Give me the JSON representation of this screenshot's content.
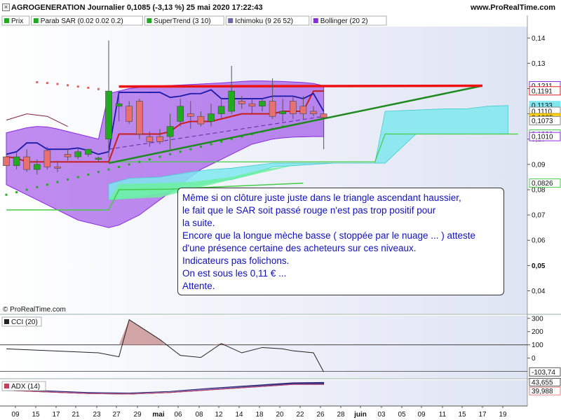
{
  "header": {
    "title": "AGROGENERATION Journalier 0,1085 (-3,13 %) 25 mai 2020 17:22:43",
    "site": "www.ProRealTime.com",
    "close_glyph": "×"
  },
  "legend": [
    {
      "label": "Prix",
      "color": "#22aa22"
    },
    {
      "label": "Parab SAR (0.02 0.02 0.2)",
      "color": "#22aa22"
    },
    {
      "label": "SuperTrend (3 10)",
      "color": "#22aa22"
    },
    {
      "label": "Ichimoku (9 26 52)",
      "color": "#6a6aaa"
    },
    {
      "label": "Bollinger (20 2)",
      "color": "#8a2be2"
    }
  ],
  "watermark": "© ProRealTime.com",
  "note": {
    "lines": [
      "Même si on clôture juste juste dans le triangle ascendant haussier,",
      "le fait que le SAR soit passé rouge n'est pas trop positif pour",
      "la suite.",
      "Encore que la longue mèche basse ( stoppée par le nuage ... )  atteste",
      "d'une présence certaine des acheteurs sur ces niveaux.",
      "Indicateurs pas folichons.",
      "On est sous les 0,11 € ...",
      "Attente."
    ]
  },
  "chart_data": [
    {
      "type": "candlestick",
      "name": "Prix",
      "y_ticks": [
        "0,14",
        "0,13",
        "0,12",
        "0,11",
        "0,10",
        "0,09",
        "0,08",
        "0,07",
        "0,06",
        "0,05",
        "0,04"
      ],
      "y_tick_values": [
        0.14,
        0.13,
        0.12,
        0.11,
        0.1,
        0.09,
        0.08,
        0.07,
        0.06,
        0.05,
        0.04
      ],
      "bold_tick": "0,05",
      "ylim": [
        0.031,
        0.1445
      ],
      "x_ticks": [
        "09",
        "15",
        "17",
        "21",
        "23",
        "27",
        "29",
        "mai",
        "06",
        "08",
        "12",
        "14",
        "18",
        "20",
        "22",
        "26",
        "28",
        "juin",
        "03",
        "05",
        "09",
        "11",
        "15",
        "17",
        "19"
      ],
      "candles": [
        {
          "o": 0.093,
          "h": 0.094,
          "l": 0.089,
          "c": 0.0895
        },
        {
          "o": 0.0895,
          "h": 0.095,
          "l": 0.088,
          "c": 0.093
        },
        {
          "o": 0.093,
          "h": 0.096,
          "l": 0.087,
          "c": 0.088
        },
        {
          "o": 0.088,
          "h": 0.092,
          "l": 0.086,
          "c": 0.09
        },
        {
          "o": 0.0955,
          "h": 0.097,
          "l": 0.088,
          "c": 0.089
        },
        {
          "o": 0.089,
          "h": 0.0915,
          "l": 0.087,
          "c": 0.0885
        },
        {
          "o": 0.094,
          "h": 0.096,
          "l": 0.0915,
          "c": 0.093
        },
        {
          "o": 0.093,
          "h": 0.0965,
          "l": 0.092,
          "c": 0.095
        },
        {
          "o": 0.094,
          "h": 0.096,
          "l": 0.093,
          "c": 0.096
        },
        {
          "o": 0.092,
          "h": 0.093,
          "l": 0.091,
          "c": 0.0925
        },
        {
          "o": 0.1,
          "h": 0.139,
          "l": 0.0925,
          "c": 0.119
        },
        {
          "o": 0.113,
          "h": 0.118,
          "l": 0.107,
          "c": 0.114
        },
        {
          "o": 0.113,
          "h": 0.115,
          "l": 0.106,
          "c": 0.107
        },
        {
          "o": 0.115,
          "h": 0.116,
          "l": 0.1,
          "c": 0.102
        },
        {
          "o": 0.101,
          "h": 0.103,
          "l": 0.097,
          "c": 0.099
        },
        {
          "o": 0.101,
          "h": 0.104,
          "l": 0.098,
          "c": 0.099
        },
        {
          "o": 0.101,
          "h": 0.11,
          "l": 0.096,
          "c": 0.105
        },
        {
          "o": 0.107,
          "h": 0.116,
          "l": 0.105,
          "c": 0.113
        },
        {
          "o": 0.11,
          "h": 0.115,
          "l": 0.104,
          "c": 0.109
        },
        {
          "o": 0.109,
          "h": 0.111,
          "l": 0.105,
          "c": 0.106
        },
        {
          "o": 0.107,
          "h": 0.114,
          "l": 0.105,
          "c": 0.11
        },
        {
          "o": 0.11,
          "h": 0.116,
          "l": 0.108,
          "c": 0.113
        },
        {
          "o": 0.111,
          "h": 0.129,
          "l": 0.11,
          "c": 0.119
        },
        {
          "o": 0.115,
          "h": 0.117,
          "l": 0.112,
          "c": 0.114
        },
        {
          "o": 0.114,
          "h": 0.116,
          "l": 0.11,
          "c": 0.113
        },
        {
          "o": 0.113,
          "h": 0.116,
          "l": 0.111,
          "c": 0.115
        },
        {
          "o": 0.115,
          "h": 0.124,
          "l": 0.108,
          "c": 0.109
        },
        {
          "o": 0.11,
          "h": 0.116,
          "l": 0.107,
          "c": 0.111
        },
        {
          "o": 0.115,
          "h": 0.117,
          "l": 0.108,
          "c": 0.11
        },
        {
          "o": 0.113,
          "h": 0.117,
          "l": 0.108,
          "c": 0.11
        },
        {
          "o": 0.111,
          "h": 0.113,
          "l": 0.109,
          "c": 0.11
        },
        {
          "o": 0.11,
          "h": 0.111,
          "l": 0.096,
          "c": 0.1085
        }
      ],
      "price_labels": [
        {
          "text": "0,1211",
          "value": 0.1211,
          "bg": "#ffffff",
          "border": "#8a2be2",
          "color": "#111111"
        },
        {
          "text": "0,1191",
          "value": 0.1191,
          "bg": "#ffffff",
          "border": "#e02020",
          "color": "#111111"
        },
        {
          "text": "0,1133",
          "value": 0.1133,
          "bg": "#7fe8ef",
          "border": "#7fe8ef",
          "color": "#111111"
        },
        {
          "text": "0,1110",
          "value": 0.111,
          "bg": "#ffffff",
          "border": "#888888",
          "color": "#111111"
        },
        {
          "text": "0,1085",
          "value": 0.1085,
          "bg": "#ffd21a",
          "border": "#c8a000",
          "color": "#111111"
        },
        {
          "text": "0,1073",
          "value": 0.1073,
          "bg": "#ffffff",
          "border": "#888888",
          "color": "#111111"
        },
        {
          "text": "0,1020",
          "value": 0.102,
          "bg": "#ffffff",
          "border": "#44cc44",
          "color": "#111111"
        },
        {
          "text": "0,1010",
          "value": 0.101,
          "bg": "#ffffff",
          "border": "#8a2be2",
          "color": "#111111"
        },
        {
          "text": "0,0826",
          "value": 0.0826,
          "bg": "#ffffff",
          "border": "#44cc44",
          "color": "#111111"
        }
      ],
      "colors": {
        "up": "#22aa22",
        "down": "#e87070",
        "wick": "#555555",
        "bollinger": "#8a2be2",
        "cloud_green": "#6cf0a0",
        "cloud_cyan": "#7fe8ef",
        "supertrend": "#c81e1e",
        "tenkan": "#1a1aaa",
        "trendline": "#1e8a1e",
        "resistance": "#ee1111"
      }
    },
    {
      "type": "line",
      "name": "CCI (20)",
      "y_ticks": [
        "300",
        "200",
        "100",
        "0"
      ],
      "y_tick_values": [
        300,
        200,
        100,
        0
      ],
      "ylim": [
        -150,
        320
      ],
      "last_value_label": "-103,74",
      "reference_line": 100,
      "x": [
        0,
        3,
        6,
        9,
        11,
        12,
        15,
        17,
        19,
        21,
        23,
        25,
        27,
        28,
        30,
        31
      ],
      "values": [
        70,
        60,
        50,
        40,
        10,
        290,
        140,
        20,
        5,
        110,
        40,
        80,
        70,
        55,
        40,
        -104
      ]
    },
    {
      "type": "area",
      "name": "ADX (14)",
      "last_value_labels": [
        "43,655",
        "39,988"
      ],
      "x": [
        0,
        4,
        8,
        12,
        16,
        20,
        24,
        28,
        31
      ],
      "values": [
        30,
        28,
        25,
        24,
        27,
        33,
        38,
        43,
        43.6
      ],
      "values_2": [
        29,
        26,
        23,
        22,
        25,
        30,
        35,
        40,
        40
      ]
    }
  ]
}
